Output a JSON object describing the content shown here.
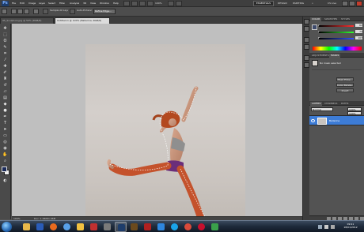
{
  "menubar": {
    "app_logo": "Ps",
    "items": [
      "File",
      "Edit",
      "Image",
      "Layer",
      "Select",
      "Filter",
      "Analysis",
      "3D",
      "View",
      "Window",
      "Help"
    ],
    "zoom": "100%",
    "workspaces": {
      "active": "ESSENTIALS",
      "others": [
        "DESIGN",
        "PAINTING"
      ]
    },
    "cs_live": "CS Live"
  },
  "options": {
    "sample_label": "Sample All Layers",
    "auto_enhance_label": "Auto-Enhance",
    "refine_edge_label": "Refine Edge..."
  },
  "tabs": [
    {
      "label": "95_Sculpture.jpg @ 50% (RGB/8)"
    },
    {
      "label": "Untitled-1 @ 100% (Ballerina, RGB/8)"
    }
  ],
  "status": {
    "zoom": "100%",
    "doc": "Doc: 1.06M/1.06M"
  },
  "panels": {
    "color": {
      "tabs": [
        "COLOR",
        "SWATCHES",
        "STYLES"
      ],
      "channels": [
        {
          "label": "R",
          "value": "62"
        },
        {
          "label": "G",
          "value": "74"
        },
        {
          "label": "B",
          "value": "107"
        }
      ]
    },
    "adjustments": {
      "tabs": [
        "ADJUSTMENTS",
        "MASKS"
      ],
      "message": "No mask selected",
      "buttons": [
        "Mask Edge...",
        "Color Range...",
        "Invert"
      ]
    },
    "layers": {
      "tabs": [
        "LAYERS",
        "CHANNELS",
        "PATHS"
      ],
      "blend_mode": "Normal",
      "opacity": "100%",
      "fill": "100%",
      "layer_name": "Ballerina"
    }
  },
  "taskbar": {
    "time": "09:11",
    "date": "18/01/2012"
  },
  "colors": {
    "accent_layer": "#3d7cd6",
    "workspace_bg": "#535353"
  }
}
